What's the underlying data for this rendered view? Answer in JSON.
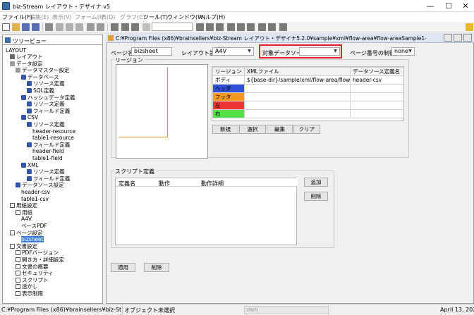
{
  "window": {
    "title": "biz-Stream レイアウト・デザイナ v5",
    "min_glyph": "—",
    "max_glyph": "☐",
    "close_glyph": "✕"
  },
  "menu": [
    "ファイル(F)",
    "編集(E)",
    "表示(V)",
    "フォーム(I)",
    "表(D)",
    "グラフ(C)",
    "ツール(T)",
    "ウィンドウ(W)",
    "ヘルプ(H)"
  ],
  "tree_tab": {
    "label": "ツリービュー"
  },
  "tree_root": "LAYOUT",
  "tree": [
    {
      "label": "レイアウト",
      "icon": "lay"
    },
    {
      "label": "データ設定",
      "icon": "grp"
    },
    {
      "label": "データマスター設定",
      "icon": "grp"
    },
    {
      "label": "データベース",
      "icon": "db"
    },
    {
      "label": "リソース定義",
      "icon": "db"
    },
    {
      "label": "SQL定義",
      "icon": "db"
    },
    {
      "label": "ハッシュデータ定義",
      "icon": "db"
    },
    {
      "label": "リソース定義",
      "icon": "db"
    },
    {
      "label": "フィールド定義",
      "icon": "db"
    },
    {
      "label": "CSV",
      "icon": "db"
    },
    {
      "label": "リソース定義",
      "icon": "db"
    },
    {
      "label": "header-resource",
      "icon": ""
    },
    {
      "label": "table1-resource",
      "icon": ""
    },
    {
      "label": "フィールド定義",
      "icon": "db"
    },
    {
      "label": "header-field",
      "icon": ""
    },
    {
      "label": "table1-field",
      "icon": ""
    },
    {
      "label": "XML",
      "icon": "db"
    },
    {
      "label": "リソース定義",
      "icon": "db"
    },
    {
      "label": "フィールド定義",
      "icon": "db"
    },
    {
      "label": "データソース設定",
      "icon": "db"
    },
    {
      "label": "header-csv",
      "icon": ""
    },
    {
      "label": "table1-csv",
      "icon": ""
    },
    {
      "label": "用紙設定",
      "icon": "doc"
    },
    {
      "label": "用紙",
      "icon": "doc"
    },
    {
      "label": "A4V",
      "icon": ""
    },
    {
      "label": "ベースPDF",
      "icon": ""
    },
    {
      "label": "ページ設定",
      "icon": "doc"
    },
    {
      "label": "bizsheet",
      "icon": ""
    },
    {
      "label": "文書設定",
      "icon": "doc"
    },
    {
      "label": "PDFバージョン",
      "icon": "doc"
    },
    {
      "label": "開き方・詳細設定",
      "icon": "doc"
    },
    {
      "label": "文書の概要",
      "icon": "doc"
    },
    {
      "label": "セキュリティ",
      "icon": "doc"
    },
    {
      "label": "スクリプト",
      "icon": "doc"
    },
    {
      "label": "透かし",
      "icon": "doc"
    },
    {
      "label": "表示制限",
      "icon": "doc"
    }
  ],
  "doc": {
    "title": "C:¥Program Files (x86)¥brainsellers¥biz-Stream レイアウト・デザイナ5.2.0¥sample¥xml¥flow-area¥flow-areaSample1-doc.xml [v5.0.0]",
    "page_name_label": "ページ名",
    "page_name_value": "bizsheet",
    "layout_label": "レイアウト設定",
    "layout_value": "A4V",
    "target_ds_label": "対象データソース",
    "target_ds_value": "",
    "page_num_label": "ページ番号の制御",
    "page_num_value": "none",
    "region_group_label": "リージョン",
    "region_headers": [
      "リージョン",
      "XMLファイル",
      "データソース定義名"
    ],
    "regions": [
      {
        "name": "ボディ",
        "color": "#ffffff",
        "xml": "${base-dir}/sample/xml/flow-area/flow-area...",
        "ds": "header-csv"
      },
      {
        "name": "ヘッダ",
        "color": "#2f4fd6",
        "xml": "",
        "ds": ""
      },
      {
        "name": "フッタ",
        "color": "#f79a25",
        "xml": "",
        "ds": ""
      },
      {
        "name": "左",
        "color": "#ee3333",
        "xml": "",
        "ds": ""
      },
      {
        "name": "右",
        "color": "#55e04a",
        "xml": "",
        "ds": ""
      }
    ],
    "region_buttons": [
      "新規",
      "選択",
      "編集",
      "クリア"
    ],
    "script_group_label": "スクリプト定義",
    "script_headers": [
      "定義名",
      "動作",
      "動作詳細"
    ],
    "script_buttons": [
      "追加",
      "削除"
    ],
    "apply_label": "適用",
    "delete_label": "削除"
  },
  "status": {
    "path": "C:¥Program Files (x86)¥brainsellers¥biz-Strea...",
    "object": "オブジェクト未選択",
    "unit": "mm",
    "date": "April 13, 2023"
  },
  "colors": {
    "target_ds_highlight": "#e0202a",
    "selection": "#3a7bd5"
  }
}
